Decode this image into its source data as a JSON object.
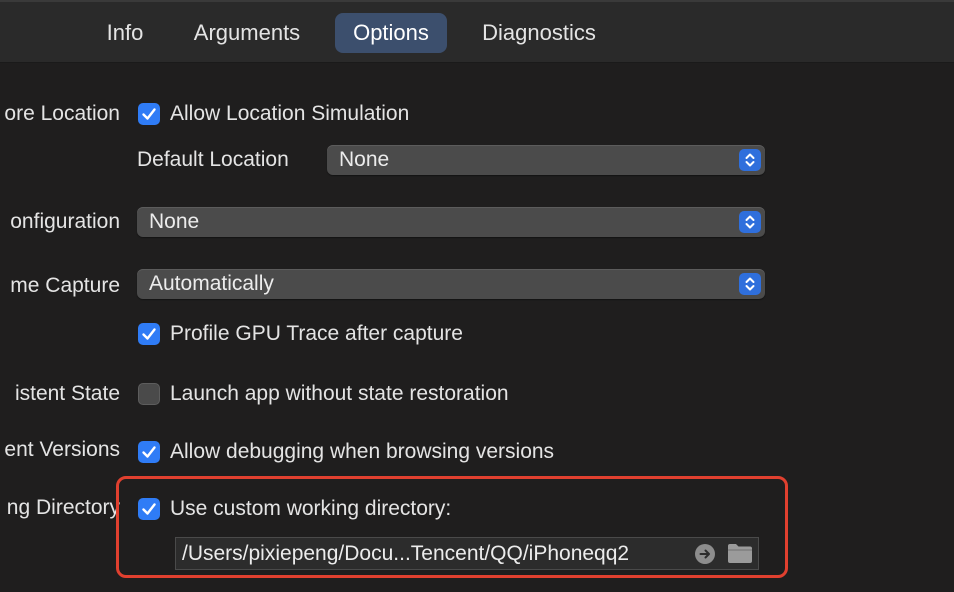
{
  "tabs": [
    {
      "label": "Info",
      "active": false
    },
    {
      "label": "Arguments",
      "active": false
    },
    {
      "label": "Options",
      "active": true
    },
    {
      "label": "Diagnostics",
      "active": false
    }
  ],
  "rows": {
    "core_location": {
      "label": "ore Location",
      "checkbox_label": "Allow Location Simulation",
      "checked": true,
      "default_location_label": "Default Location",
      "default_location_value": "None"
    },
    "configuration": {
      "label": "onfiguration",
      "value": "None"
    },
    "frame_capture": {
      "label": "me Capture",
      "value": "Automatically",
      "checkbox_label": "Profile GPU Trace after capture",
      "checked": true
    },
    "persistent_state": {
      "label": "istent State",
      "checkbox_label": "Launch app without state restoration",
      "checked": false
    },
    "document_versions": {
      "label": "ent Versions",
      "checkbox_label": "Allow debugging when browsing versions",
      "checked": true
    },
    "working_directory": {
      "label": "ng Directory",
      "checkbox_label": "Use custom working directory:",
      "checked": true,
      "path": "/Users/pixiepeng/Docu...Tencent/QQ/iPhoneqq2"
    }
  },
  "colors": {
    "accent": "#2f7cf6",
    "tab_active": "#3c4f6d",
    "highlight": "#e0402f"
  },
  "icons": {
    "checkmark": "checkmark-icon",
    "popup_arrows": "chevron-up-down-icon",
    "reveal": "arrow-right-circle-icon",
    "folder": "folder-icon"
  }
}
